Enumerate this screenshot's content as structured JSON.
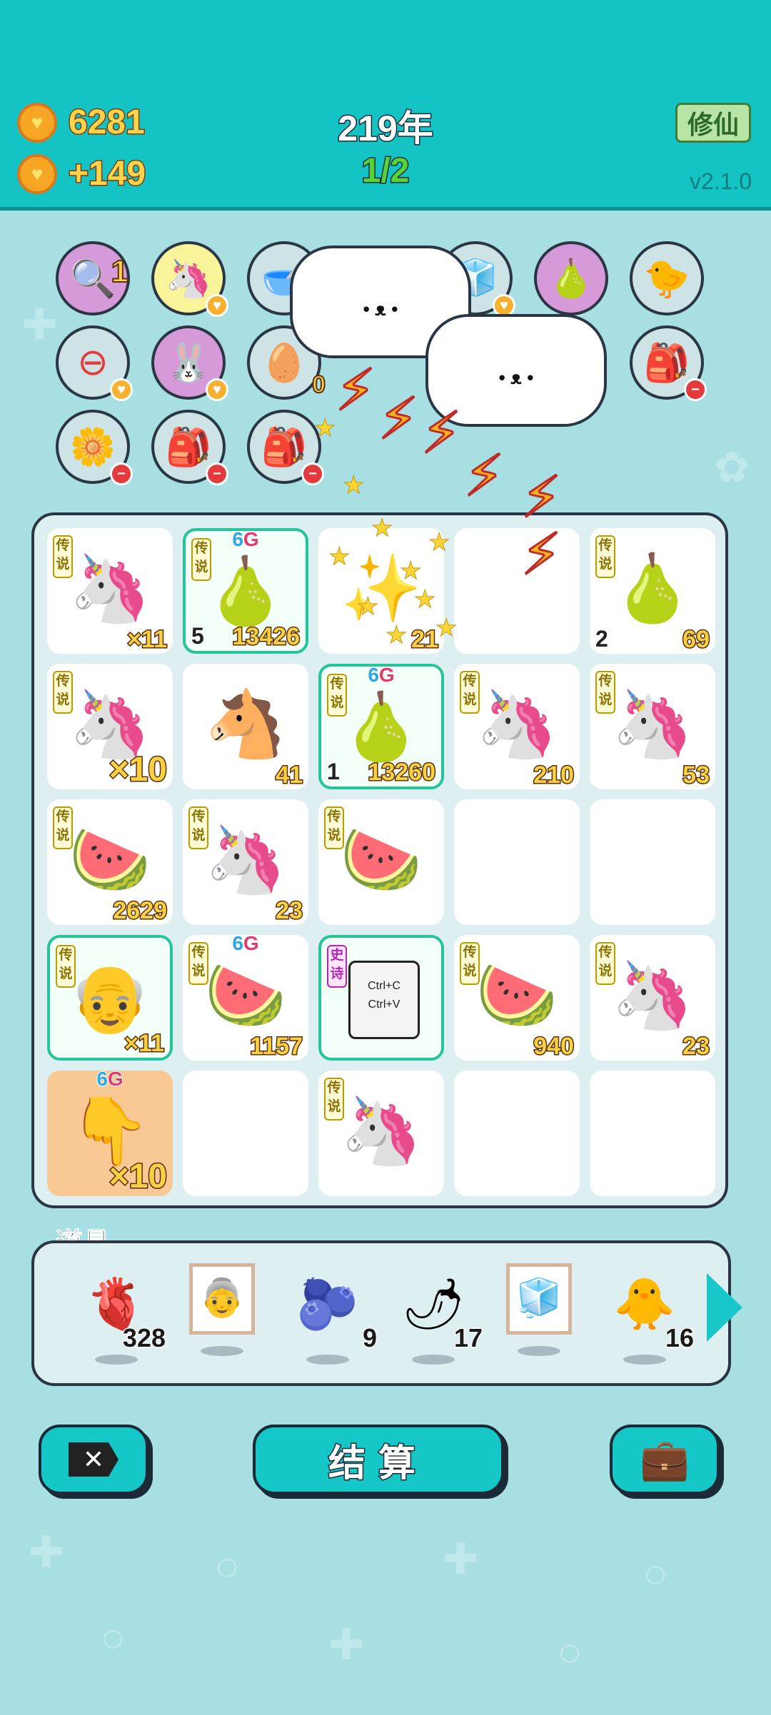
{
  "header": {
    "coins": "6281",
    "income": "+149",
    "year": "219年",
    "wave": "1/2",
    "xiuxian_label": "修仙",
    "version": "v2.1.0"
  },
  "symbols": {
    "legend_badge": "传说",
    "epic_badge": "史诗",
    "six": "6",
    "g": "G"
  },
  "item_row_labels": {
    "r1_c1_level": "1",
    "r2_c3_level": "0"
  },
  "board": {
    "cells": [
      {
        "count": "×11"
      },
      {
        "count": "13426",
        "level": "5"
      },
      {
        "count": "21"
      },
      {
        "count": ""
      },
      {
        "count": "69",
        "level": "2"
      },
      {
        "count": "×10"
      },
      {
        "count": "41"
      },
      {
        "count": "13260",
        "level": "1"
      },
      {
        "count": "210"
      },
      {
        "count": "53"
      },
      {
        "count": "2629"
      },
      {
        "count": "23"
      },
      {
        "count": ""
      },
      {
        "count": ""
      },
      {
        "count": ""
      },
      {
        "count": "×11"
      },
      {
        "count": "1157"
      },
      {
        "count": ""
      },
      {
        "count": "940"
      },
      {
        "count": "23"
      },
      {
        "count": "×10"
      },
      {
        "count": ""
      },
      {
        "count": ""
      },
      {
        "count": ""
      },
      {
        "count": ""
      }
    ],
    "copy_card": [
      "Ctrl+C",
      "Ctrl+V"
    ]
  },
  "tools": {
    "title": "道具",
    "items": [
      {
        "icon": "liver-icon",
        "count": "328"
      },
      {
        "icon": "portrait-icon",
        "count": ""
      },
      {
        "icon": "blueberry-icon",
        "count": "9"
      },
      {
        "icon": "chili-pepper-icon",
        "count": "17"
      },
      {
        "icon": "fridge-frame-icon",
        "count": ""
      },
      {
        "icon": "duck-icon",
        "count": "16"
      }
    ]
  },
  "buttons": {
    "settle": "结算"
  },
  "colors": {
    "header": "#14c3c4",
    "background": "#a7dfe3",
    "accent": "#15c7c7"
  }
}
